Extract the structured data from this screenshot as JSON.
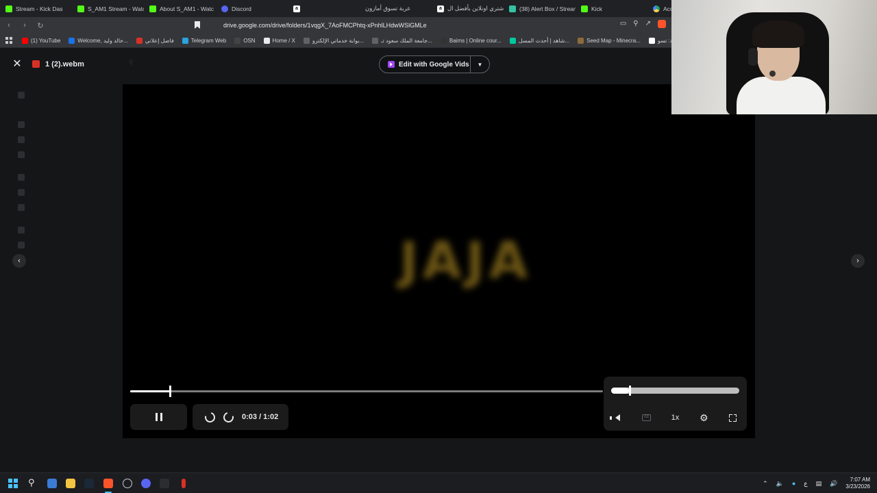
{
  "browser": {
    "tabs": [
      {
        "label": "Stream - Kick Das",
        "icon": "kick",
        "muted": true
      },
      {
        "label": "S_AM1 Stream - Watc",
        "icon": "kick"
      },
      {
        "label": "About S_AM1 - Watc",
        "icon": "kick"
      },
      {
        "label": "Discord",
        "icon": "discord"
      },
      {
        "label": "",
        "icon": "amazon"
      },
      {
        "label": "عربة تسوق أمازون",
        "icon": "none"
      },
      {
        "label": "اشتري اونلاين بأفضل ال",
        "icon": "amazon"
      },
      {
        "label": "(38) Alert Box / Stream",
        "icon": "alert"
      },
      {
        "label": "Kick",
        "icon": "kick"
      },
      {
        "label": "Access denied",
        "icon": "drive"
      }
    ],
    "url": "drive.google.com/drive/folders/1vqgX_7AoFMCPhtq-xPnhlLHdwWSlGMLe",
    "bookmarks": [
      {
        "label": "(1) YouTube",
        "color": "#ff0000"
      },
      {
        "label": "Welcome, خالد وليد...",
        "color": "#1a73e8"
      },
      {
        "label": "فاصل إعلاني",
        "color": "#d93025"
      },
      {
        "label": "Telegram Web",
        "color": "#2aa3df"
      },
      {
        "label": "OSN",
        "color": "#444444"
      },
      {
        "label": "Home / X",
        "color": "#e8eaed"
      },
      {
        "label": "بوابة خدماتي الإلكترو...",
        "color": "#5f6368"
      },
      {
        "label": "جامعة الملك سعود تـ...",
        "color": "#5f6368"
      },
      {
        "label": "Baims | Online cour...",
        "color": "#333333"
      },
      {
        "label": "شاهد | أحدث المسل...",
        "color": "#00c8a0"
      },
      {
        "label": "Seed Map - Minecra...",
        "color": "#8b6b3a"
      },
      {
        "label": "السعودية: تسو...",
        "color": "#ffffff"
      }
    ]
  },
  "viewer": {
    "file_name": "1 (2).webm",
    "edit_button_label": "Edit with Google Vids",
    "overlay_text": "JAJA",
    "time_display": "0:03 / 1:02",
    "progress_fraction": 0.084,
    "volume_fraction": 0.14,
    "speed_label": "1x",
    "cc_label": "CC"
  },
  "taskbar": {
    "time": "7:07 AM",
    "date": "3/23/2026",
    "lang": "ع"
  },
  "colors": {
    "accent": "#4cc2ff",
    "overlay_text": "#6a5414",
    "vids_purple": "#a142f4"
  }
}
